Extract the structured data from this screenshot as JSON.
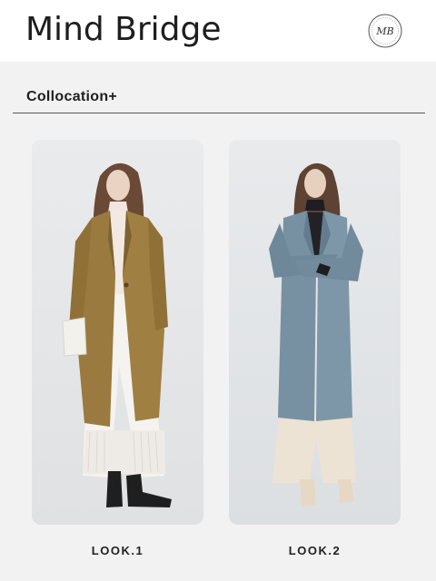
{
  "brand": {
    "name": "Mind Bridge",
    "logo_text": "MB"
  },
  "section": {
    "title": "Collocation+"
  },
  "looks": [
    {
      "label": "LOOK.1",
      "image": "model in camel wool coat with white turtleneck, white pleated wide pants and black boots, holding white bag"
    },
    {
      "label": "LOOK.2",
      "image": "model in slate-blue wool coat with black turtleneck and cream wide pants, arms crossed"
    }
  ],
  "colors": {
    "background": "#f2f2f2",
    "coat_camel": "#9a7a3e",
    "coat_blue": "#7891a2",
    "photo_bg": "#e6e8ea"
  }
}
